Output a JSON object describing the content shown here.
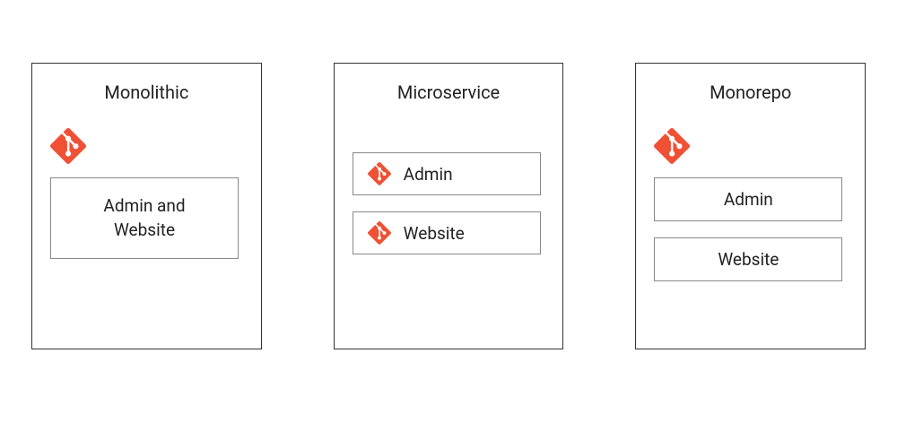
{
  "git_color": "#F05033",
  "panels": [
    {
      "title": "Monolithic",
      "has_outer_git": true,
      "content_single": "Admin and Website",
      "items": []
    },
    {
      "title": "Microservice",
      "has_outer_git": false,
      "content_single": "",
      "items": [
        {
          "label": "Admin",
          "has_git": true
        },
        {
          "label": "Website",
          "has_git": true
        }
      ]
    },
    {
      "title": "Monorepo",
      "has_outer_git": true,
      "content_single": "",
      "items": [
        {
          "label": "Admin",
          "has_git": false
        },
        {
          "label": "Website",
          "has_git": false
        }
      ]
    }
  ]
}
